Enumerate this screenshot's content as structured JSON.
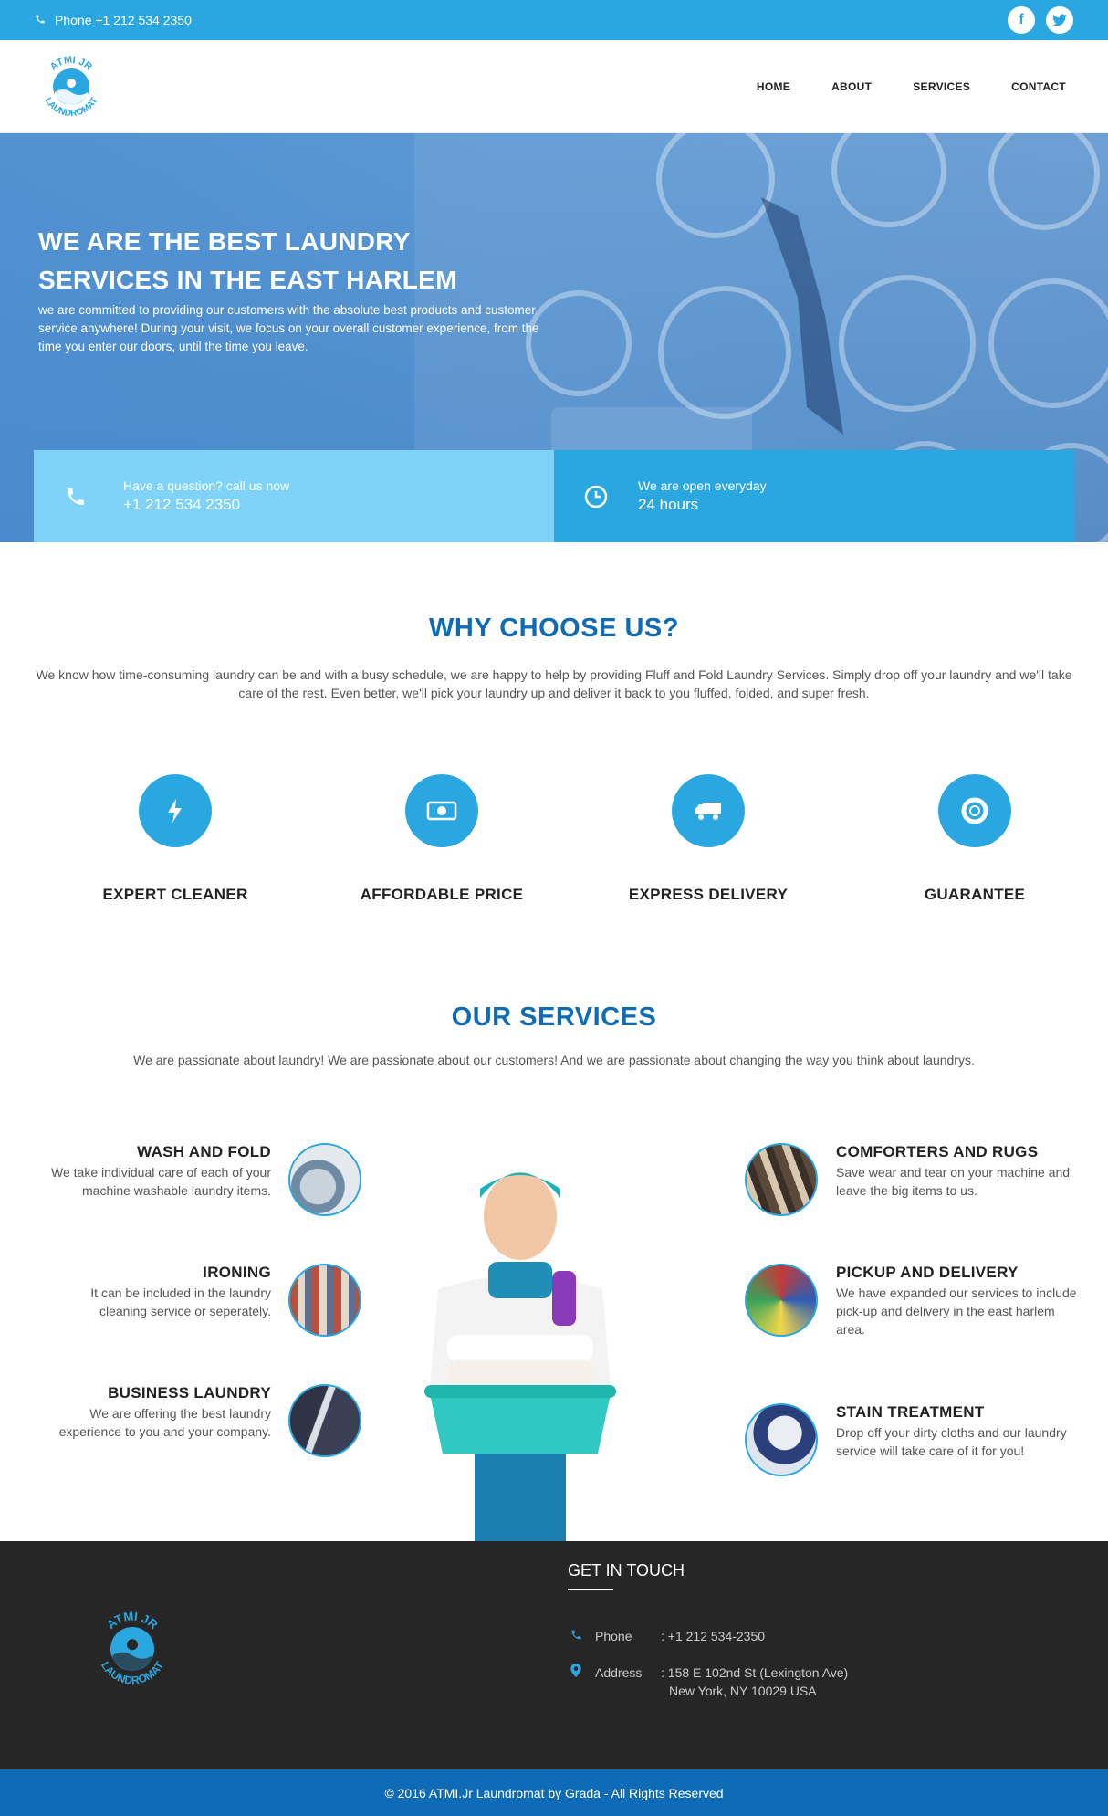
{
  "topbar": {
    "phone": "Phone +1 212 534 2350",
    "social": {
      "facebook": "f",
      "twitter": "t"
    }
  },
  "logo": {
    "top_text": "ATMI JR",
    "bottom_text": "LAUNDROMAT"
  },
  "nav": {
    "items": [
      "HOME",
      "ABOUT",
      "SERVICES",
      "CONTACT"
    ]
  },
  "hero": {
    "title": "WE ARE THE BEST LAUNDRY SERVICES IN THE EAST HARLEM",
    "text": "we are committed to providing our customers with the absolute best products and customer service anywhere! During your visit, we focus on your overall customer experience, from the time you enter our doors, until the time you leave.",
    "call_label": "Have a question? call us now",
    "call_value": "+1 212 534 2350",
    "open_label": "We are open everyday",
    "open_value": "24 hours"
  },
  "why": {
    "heading": "WHY CHOOSE US?",
    "text": "We know how time-consuming laundry can be and with a busy schedule, we are happy to help by providing Fluff and Fold Laundry Services. Simply drop off your laundry and we'll take care of the rest. Even better, we'll pick your laundry up and deliver it back to you fluffed, folded, and super fresh.",
    "features": [
      {
        "label": "EXPERT CLEANER",
        "icon": "lightning-icon"
      },
      {
        "label": "AFFORDABLE PRICE",
        "icon": "money-icon"
      },
      {
        "label": "EXPRESS DELIVERY",
        "icon": "truck-icon"
      },
      {
        "label": "GUARANTEE",
        "icon": "lifebuoy-icon"
      }
    ]
  },
  "services": {
    "heading": "OUR SERVICES",
    "text": "We are passionate about laundry! We are passionate about our customers! And we are passionate about changing the way you think about laundrys.",
    "left": [
      {
        "title": "WASH AND FOLD",
        "text": "We take individual care of each of your machine washable laundry items."
      },
      {
        "title": "IRONING",
        "text": "It can be included in the laundry cleaning service or seperately."
      },
      {
        "title": "BUSINESS LAUNDRY",
        "text": "We are offering the best laundry experience to you and your company."
      }
    ],
    "right": [
      {
        "title": "COMFORTERS AND RUGS",
        "text": "Save wear and tear on your machine and leave the big items to us."
      },
      {
        "title": "PICKUP AND DELIVERY",
        "text": "We have expanded our services to include pick-up and delivery in the east harlem area."
      },
      {
        "title": "STAIN TREATMENT",
        "text": "Drop off your dirty cloths and our laundry service will take care of it for you!"
      }
    ]
  },
  "footer": {
    "heading": "GET IN TOUCH",
    "phone_key": "Phone",
    "phone_value": ": +1 212 534-2350",
    "address_key": "Address",
    "address_line1": ": 158 E 102nd St (Lexington Ave)",
    "address_line2": "New York, NY 10029 USA",
    "copyright": "© 2016 ATMI.Jr Laundromat by Grada - All Rights Reserved"
  },
  "colors": {
    "accent": "#2aa7e1",
    "heading": "#0f6bb5",
    "footer": "#262626"
  }
}
